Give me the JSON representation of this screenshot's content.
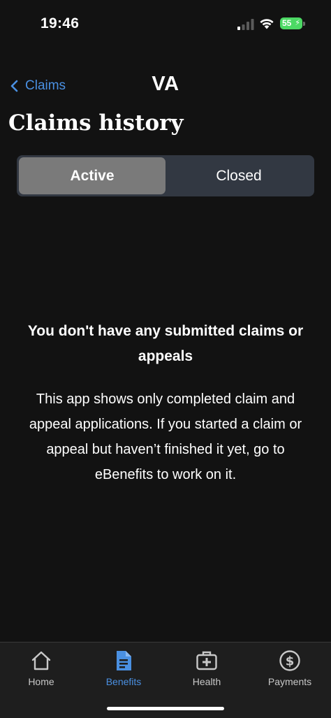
{
  "status_bar": {
    "time": "19:46",
    "battery": "55",
    "battery_color": "#4cd964"
  },
  "header": {
    "back_label": "Claims",
    "logo_text": "VA",
    "title": "Claims history",
    "accent_color": "#4a90e2"
  },
  "segments": {
    "active_label": "Active",
    "closed_label": "Closed",
    "selected": "Active"
  },
  "empty_state": {
    "heading": "You don't have any submitted claims or appeals",
    "body": "This app shows only completed claim and appeal applications. If you started a claim or appeal but haven’t finished it yet, go to eBenefits to work on it."
  },
  "tabs": [
    {
      "label": "Home",
      "icon": "home-icon"
    },
    {
      "label": "Benefits",
      "icon": "document-icon",
      "selected": true
    },
    {
      "label": "Health",
      "icon": "medical-kit-icon"
    },
    {
      "label": "Payments",
      "icon": "dollar-circle-icon"
    }
  ]
}
